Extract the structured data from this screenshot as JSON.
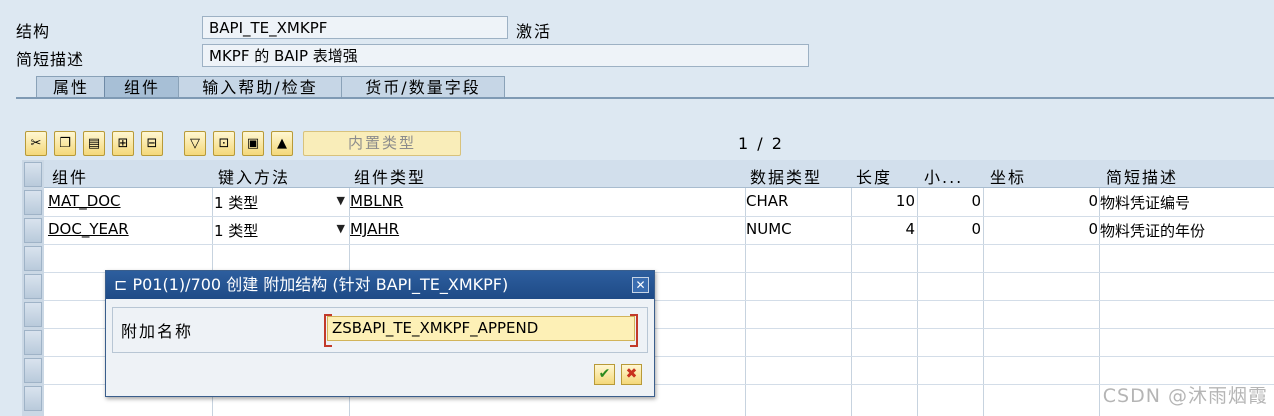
{
  "header": {
    "structure_label": "结构",
    "structure_value": "BAPI_TE_XMKPF",
    "status": "激活",
    "short_desc_label": "简短描述",
    "short_desc_value": "MKPF 的 BAIP 表增强"
  },
  "tabs": [
    {
      "label": "属性",
      "active": false
    },
    {
      "label": "组件",
      "active": true
    },
    {
      "label": "输入帮助/检查",
      "active": false
    },
    {
      "label": "货币/数量字段",
      "active": false
    }
  ],
  "toolbar": {
    "builtin_type_label": "内置类型",
    "pager": "1 / 2",
    "icons": [
      "cut-icon",
      "copy-icon",
      "paste-icon",
      "insert-row-icon",
      "delete-row-icon",
      "filter-icon",
      "tree-icon",
      "detail-icon",
      "move-up-icon"
    ]
  },
  "table": {
    "headers": [
      "组件",
      "键入方法",
      "组件类型",
      "数据类型",
      "长度",
      "小...",
      "坐标",
      "简短描述"
    ],
    "rows": [
      {
        "component": "MAT_DOC",
        "typing": "1 类型",
        "comp_type": "MBLNR",
        "data_type": "CHAR",
        "length": "10",
        "decimals": "0",
        "coord": "0",
        "desc": "物料凭证编号"
      },
      {
        "component": "DOC_YEAR",
        "typing": "1 类型",
        "comp_type": "MJAHR",
        "data_type": "NUMC",
        "length": "4",
        "decimals": "0",
        "coord": "0",
        "desc": "物料凭证的年份"
      }
    ]
  },
  "dialog": {
    "title": "P01(1)/700 创建 附加结构 (针对 BAPI_TE_XMKPF)",
    "field_label": "附加名称",
    "field_value": "ZSBAPI_TE_XMKPF_APPEND",
    "close_icon": "close-icon",
    "ok_icon": "checkmark-icon",
    "cancel_icon": "cancel-icon"
  },
  "watermark": "CSDN @沐雨烟霞",
  "colors": {
    "accent": "#1e4a86",
    "input_highlight": "#fdf0b6",
    "background": "#dde8f2"
  }
}
